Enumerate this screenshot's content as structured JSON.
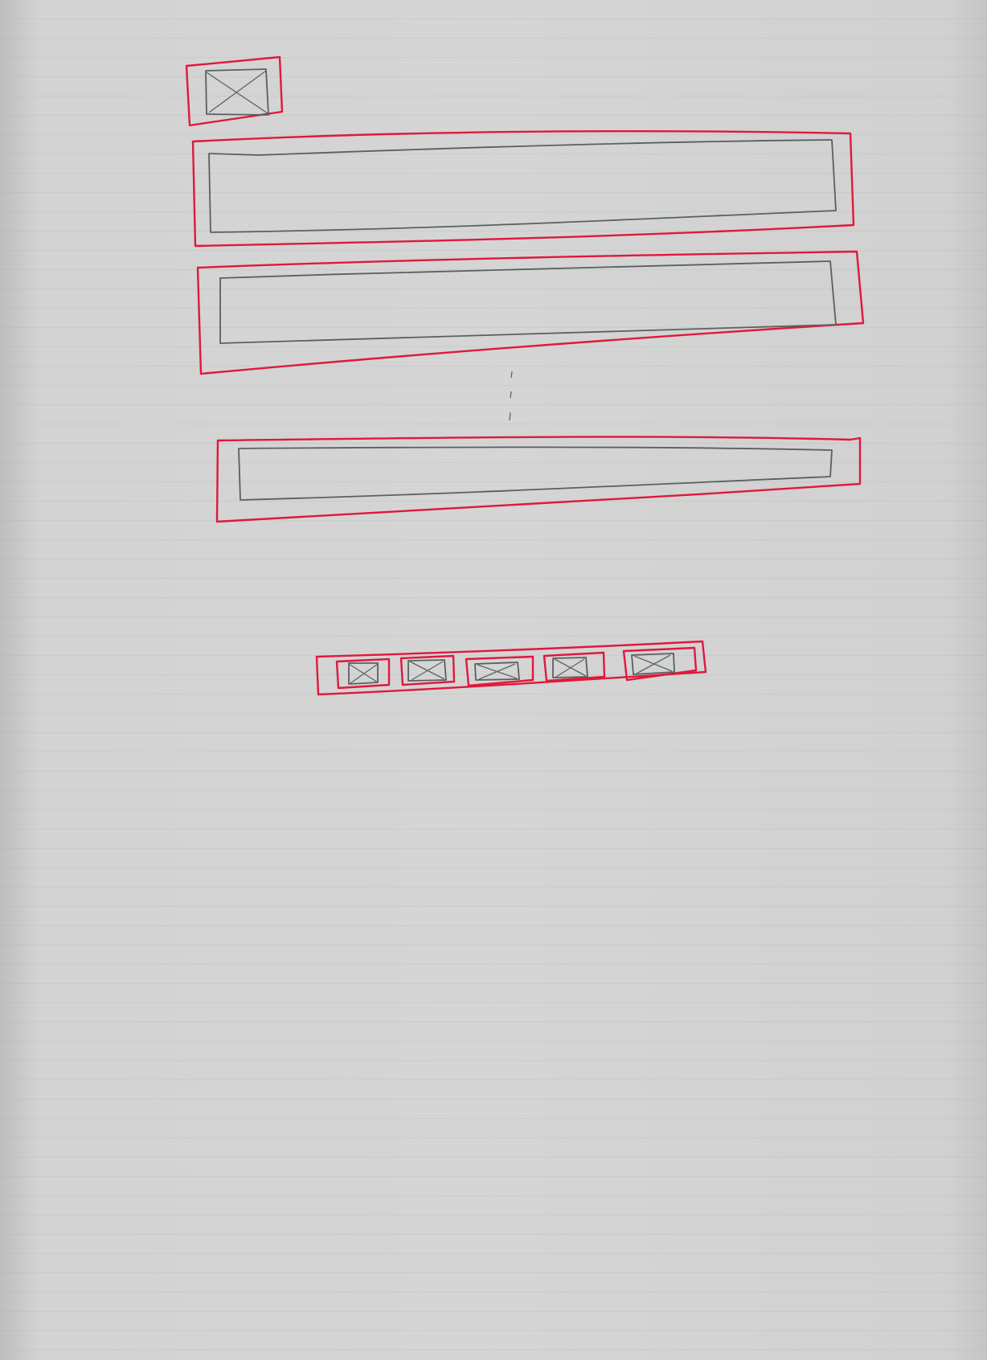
{
  "wireframe": {
    "header": {
      "logo": {
        "icon": "image-placeholder-icon"
      }
    },
    "list": {
      "rows": [
        {
          "icon": "none"
        },
        {
          "icon": "none"
        },
        {
          "icon": "none"
        }
      ],
      "continuation": "vertical-ellipsis"
    },
    "toolbar": {
      "buttons": [
        {
          "icon": "image-placeholder-icon"
        },
        {
          "icon": "image-placeholder-icon"
        },
        {
          "icon": "image-placeholder-icon"
        },
        {
          "icon": "image-placeholder-icon"
        },
        {
          "icon": "image-placeholder-icon"
        }
      ]
    }
  },
  "colors": {
    "container_outline": "#e0183c",
    "pencil": "#5a6060",
    "paper": "#d4d5d4"
  }
}
